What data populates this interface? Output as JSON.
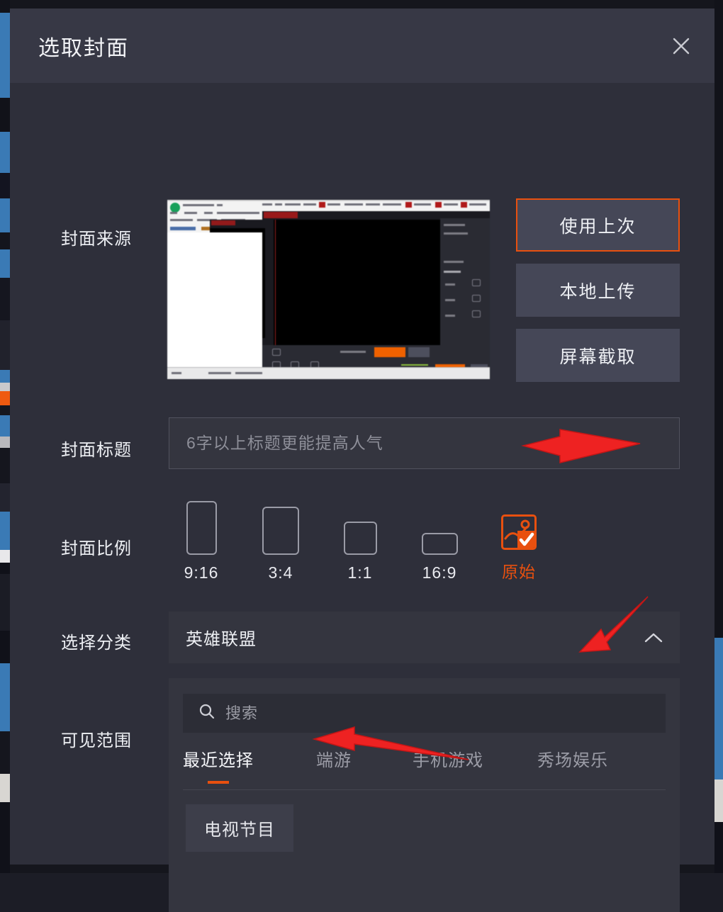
{
  "dialog": {
    "title": "选取封面",
    "close_icon": "close-icon"
  },
  "cover_source": {
    "label": "封面来源",
    "thumbnail_alt": "上次使用的封面预览",
    "buttons": [
      {
        "label": "使用上次",
        "selected": true
      },
      {
        "label": "本地上传",
        "selected": false
      },
      {
        "label": "屏幕截取",
        "selected": false
      }
    ]
  },
  "cover_title": {
    "label": "封面标题",
    "value": "",
    "placeholder": "6字以上标题更能提高人气"
  },
  "cover_ratio": {
    "label": "封面比例",
    "options": [
      {
        "label": "9:16",
        "selected": false
      },
      {
        "label": "3:4",
        "selected": false
      },
      {
        "label": "1:1",
        "selected": false
      },
      {
        "label": "16:9",
        "selected": false
      },
      {
        "label": "原始",
        "selected": true
      }
    ]
  },
  "category": {
    "label": "选择分类",
    "value": "英雄联盟",
    "chevron_icon": "chevron-up-icon",
    "expanded": true
  },
  "visible_range": {
    "label": "可见范围",
    "search": {
      "icon": "search-icon",
      "value": "",
      "placeholder": "搜索"
    },
    "tabs": [
      {
        "label": "最近选择",
        "active": true
      },
      {
        "label": "端游",
        "active": false
      },
      {
        "label": "手机游戏",
        "active": false
      },
      {
        "label": "秀场娱乐",
        "active": false
      }
    ],
    "chips": [
      {
        "label": "电视节目",
        "selected": false
      }
    ]
  },
  "colors": {
    "accent": "#e8500f",
    "dialog_bg": "#2e2f3a",
    "header_bg": "#373845",
    "field_bg": "#34353f",
    "button_bg": "#454757",
    "text_primary": "#eef0f4",
    "text_muted": "#9a9ba6",
    "annotation_red": "#ee2222",
    "backdrop_blue": "#3a7ab5"
  },
  "annotations": [
    {
      "name": "arrow-to-original-ratio",
      "direction": "left",
      "target": "原始"
    },
    {
      "name": "arrow-to-show-tab",
      "direction": "down-left",
      "target": "秀场娱乐"
    },
    {
      "name": "arrow-to-tv-chip",
      "direction": "left",
      "target": "电视节目"
    }
  ]
}
